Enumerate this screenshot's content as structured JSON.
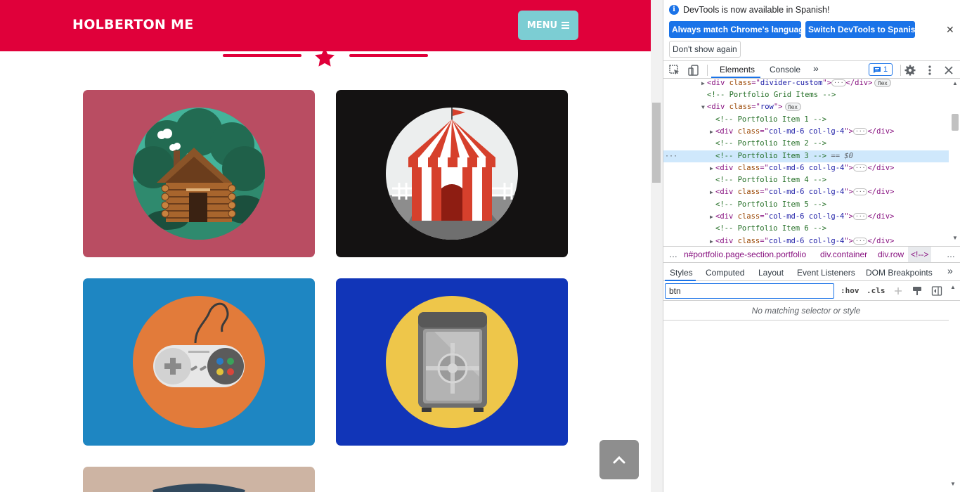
{
  "site": {
    "brand": "HOLBERTON ME",
    "menu_label": "MENU",
    "colors": {
      "navbar": "#e0003a",
      "menu_button": "#7ccdd3",
      "scroll_top": "#8e8e8e"
    },
    "portfolio_items": [
      {
        "name": "cabin",
        "bg": "#b94d62"
      },
      {
        "name": "circus-tent",
        "bg": "#141212"
      },
      {
        "name": "game-controller",
        "bg": "#1e86c2"
      },
      {
        "name": "safe",
        "bg": "#1135b8"
      },
      {
        "name": "submarine",
        "bg": "#cdb4a3"
      }
    ]
  },
  "devtools": {
    "notice": {
      "message": "DevTools is now available in Spanish!",
      "btn_match": "Always match Chrome's language",
      "btn_switch": "Switch DevTools to Spanish",
      "btn_dont_show": "Don't show again"
    },
    "tabs": {
      "elements": "Elements",
      "console": "Console",
      "issues_count": "1"
    },
    "dom": {
      "divider": {
        "tag": "div",
        "attr": "class",
        "value": "divider-custom",
        "badge": "flex"
      },
      "comment_grid": "<!-- Portfolio Grid Items -->",
      "row": {
        "tag": "div",
        "attr": "class",
        "value": "row",
        "badge": "flex"
      },
      "comments": [
        "<!-- Portfolio Item 1 -->",
        "<!-- Portfolio Item 2 -->",
        "<!-- Portfolio Item 3 -->",
        "<!-- Portfolio Item 4 -->",
        "<!-- Portfolio Item 5 -->",
        "<!-- Portfolio Item 6 -->"
      ],
      "col_value": "col-md-6 col-lg-4",
      "selected_suffix": "== $0"
    },
    "breadcrumbs": [
      "n#portfolio.page-section.portfolio",
      "div.container",
      "div.row",
      "<!-->"
    ],
    "subtabs": [
      "Styles",
      "Computed",
      "Layout",
      "Event Listeners",
      "DOM Breakpoints"
    ],
    "filter": {
      "value": "btn",
      "hov": ":hov",
      "cls": ".cls"
    },
    "no_match": "No matching selector or style"
  }
}
